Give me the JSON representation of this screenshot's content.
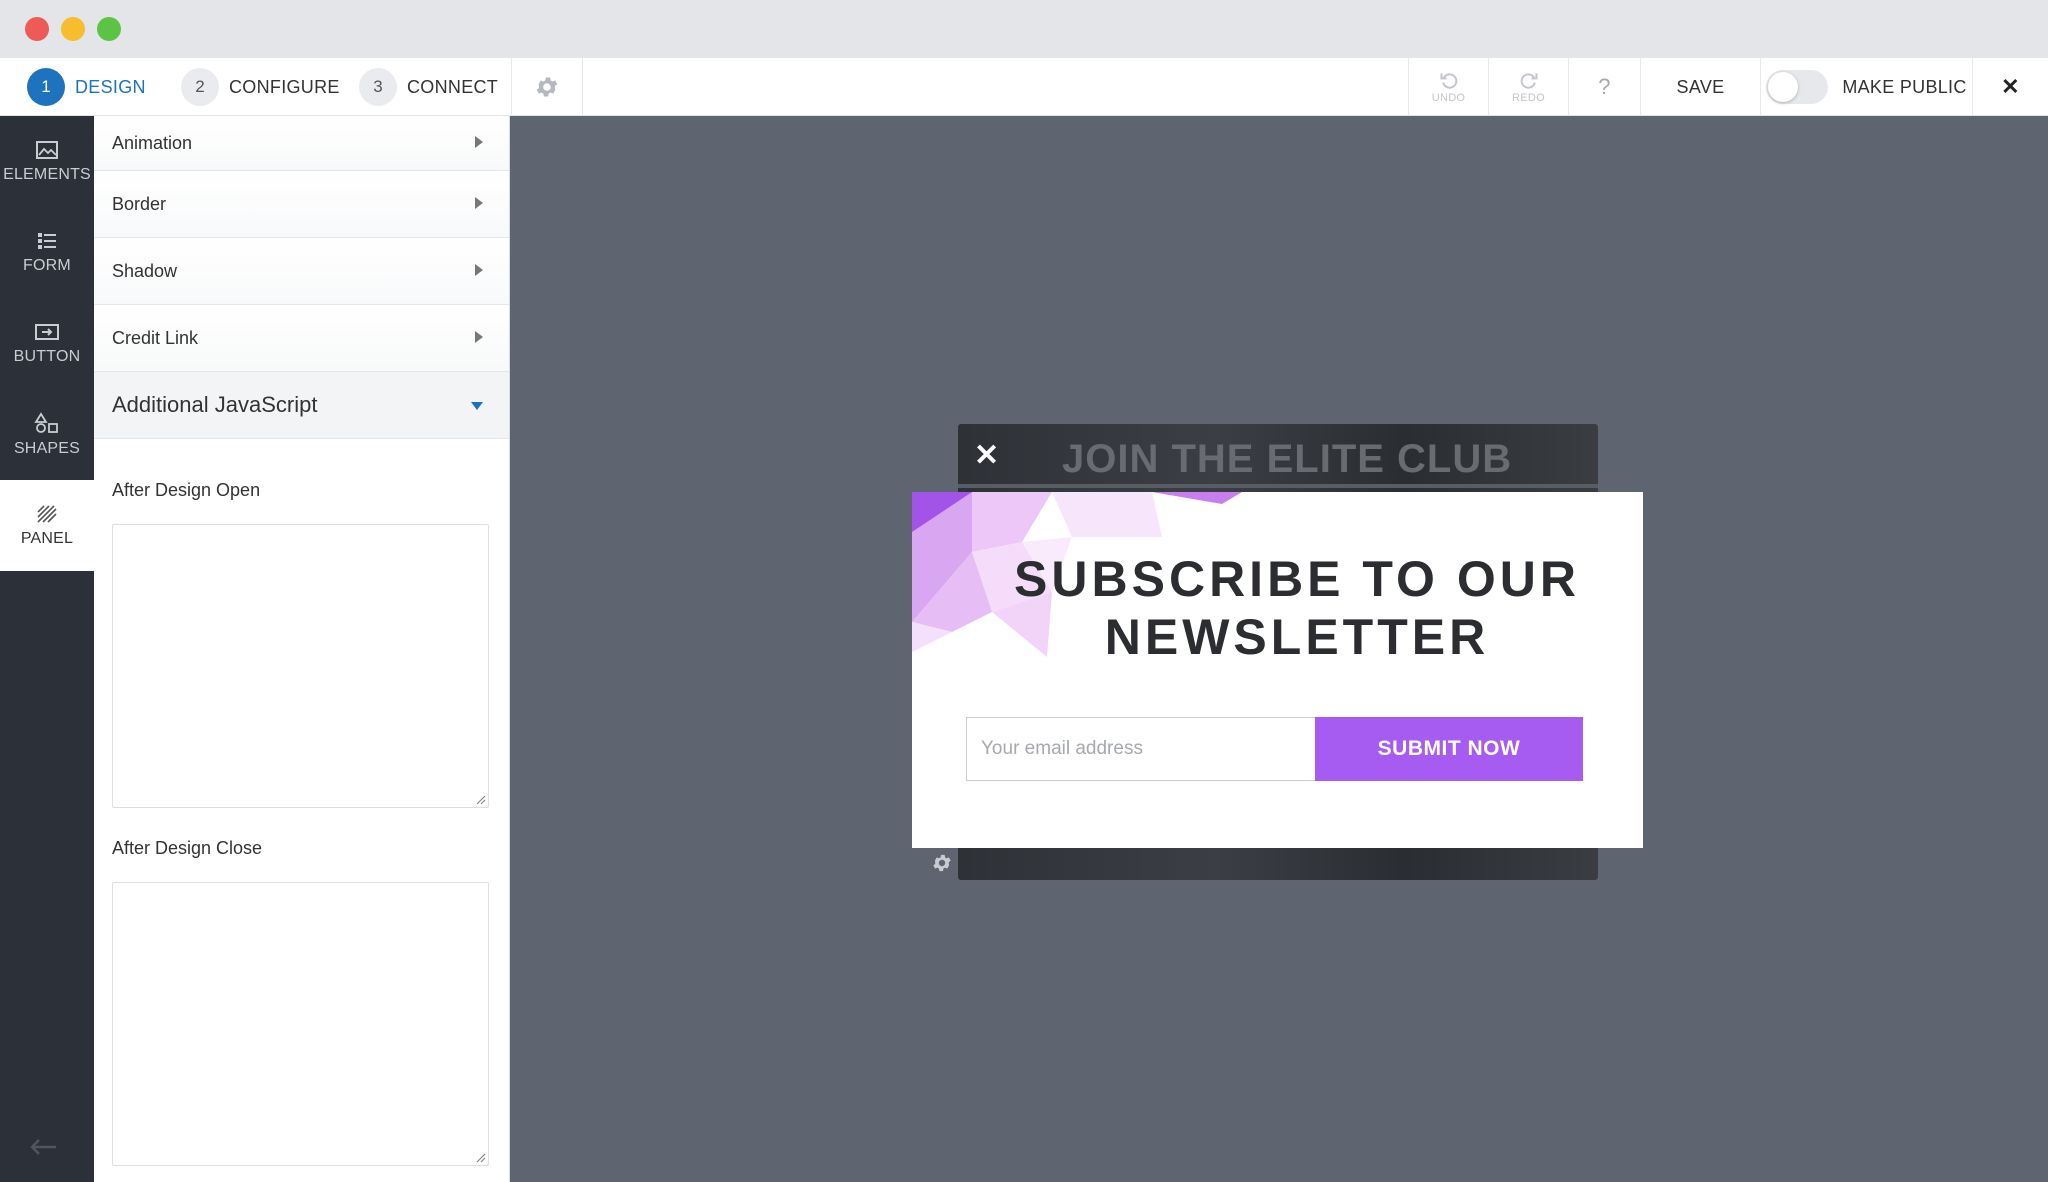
{
  "window": {
    "controls": [
      "close",
      "minimize",
      "maximize"
    ]
  },
  "toolbar": {
    "steps": [
      {
        "num": "1",
        "label": "DESIGN",
        "active": true
      },
      {
        "num": "2",
        "label": "CONFIGURE",
        "active": false
      },
      {
        "num": "3",
        "label": "CONNECT",
        "active": false
      }
    ],
    "settings_icon": "gear-icon",
    "undo_label": "UNDO",
    "redo_label": "REDO",
    "help_label": "?",
    "save_label": "SAVE",
    "make_public_label": "MAKE PUBLIC",
    "make_public_on": false,
    "close_label": "✕",
    "accent_color": "#1e73be"
  },
  "rail": {
    "items": [
      {
        "label": "ELEMENTS",
        "icon": "image-icon",
        "active": false
      },
      {
        "label": "FORM",
        "icon": "list-icon",
        "active": false
      },
      {
        "label": "BUTTON",
        "icon": "button-icon",
        "active": false
      },
      {
        "label": "SHAPES",
        "icon": "shapes-icon",
        "active": false
      },
      {
        "label": "PANEL",
        "icon": "panel-icon",
        "active": true
      }
    ],
    "back_icon": "arrow-left-icon"
  },
  "panel": {
    "sections": [
      {
        "label": "Animation"
      },
      {
        "label": "Border"
      },
      {
        "label": "Shadow"
      },
      {
        "label": "Credit Link"
      }
    ],
    "open_section": "Additional JavaScript",
    "fields": [
      {
        "label": "After Design Open",
        "value": ""
      },
      {
        "label": "After Design Close",
        "value": ""
      }
    ]
  },
  "canvas": {
    "background_card": {
      "title": "JOIN THE ELITE CLUB",
      "close_label": "✕"
    },
    "popup": {
      "headline_line1": "SUBSCRIBE TO OUR",
      "headline_line2": "NEWSLETTER",
      "email_placeholder": "Your email address",
      "submit_label": "SUBMIT NOW",
      "button_color": "#a65cf0"
    },
    "element_gear_icon": "gear-icon"
  }
}
